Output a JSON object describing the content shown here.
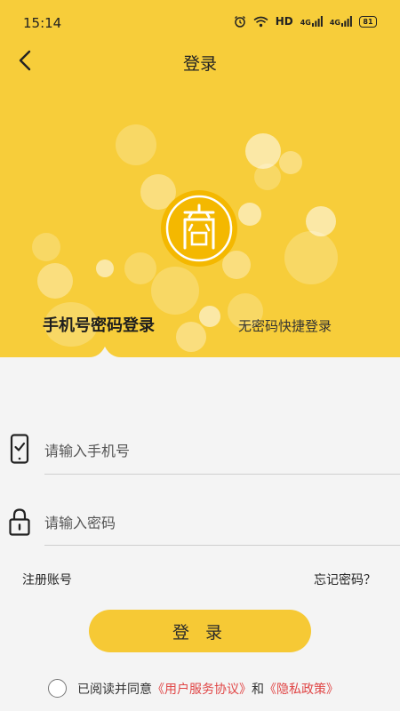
{
  "status_bar": {
    "time": "15:14",
    "network_label": "HD",
    "signal_1": "4G",
    "signal_2": "4G",
    "battery": "81"
  },
  "nav": {
    "title": "登录"
  },
  "logo": {
    "glyph": "商"
  },
  "tabs": {
    "active": "手机号密码登录",
    "inactive": "无密码快捷登录"
  },
  "form": {
    "phone_placeholder": "请输入手机号",
    "password_placeholder": "请输入密码",
    "register_link": "注册账号",
    "forgot_link": "忘记密码？",
    "submit_label": "登 录"
  },
  "agreement": {
    "prefix": "已阅读并同意",
    "user_agreement": "《用户服务协议》",
    "conjunction": "和",
    "privacy_policy": "《隐私政策》",
    "checked": false
  },
  "colors": {
    "hero_yellow": "#f7cd3a",
    "button_yellow": "#f6c935",
    "logo_yellow": "#f4b800",
    "link_red": "#e04646",
    "page_background": "#f4f4f4"
  }
}
